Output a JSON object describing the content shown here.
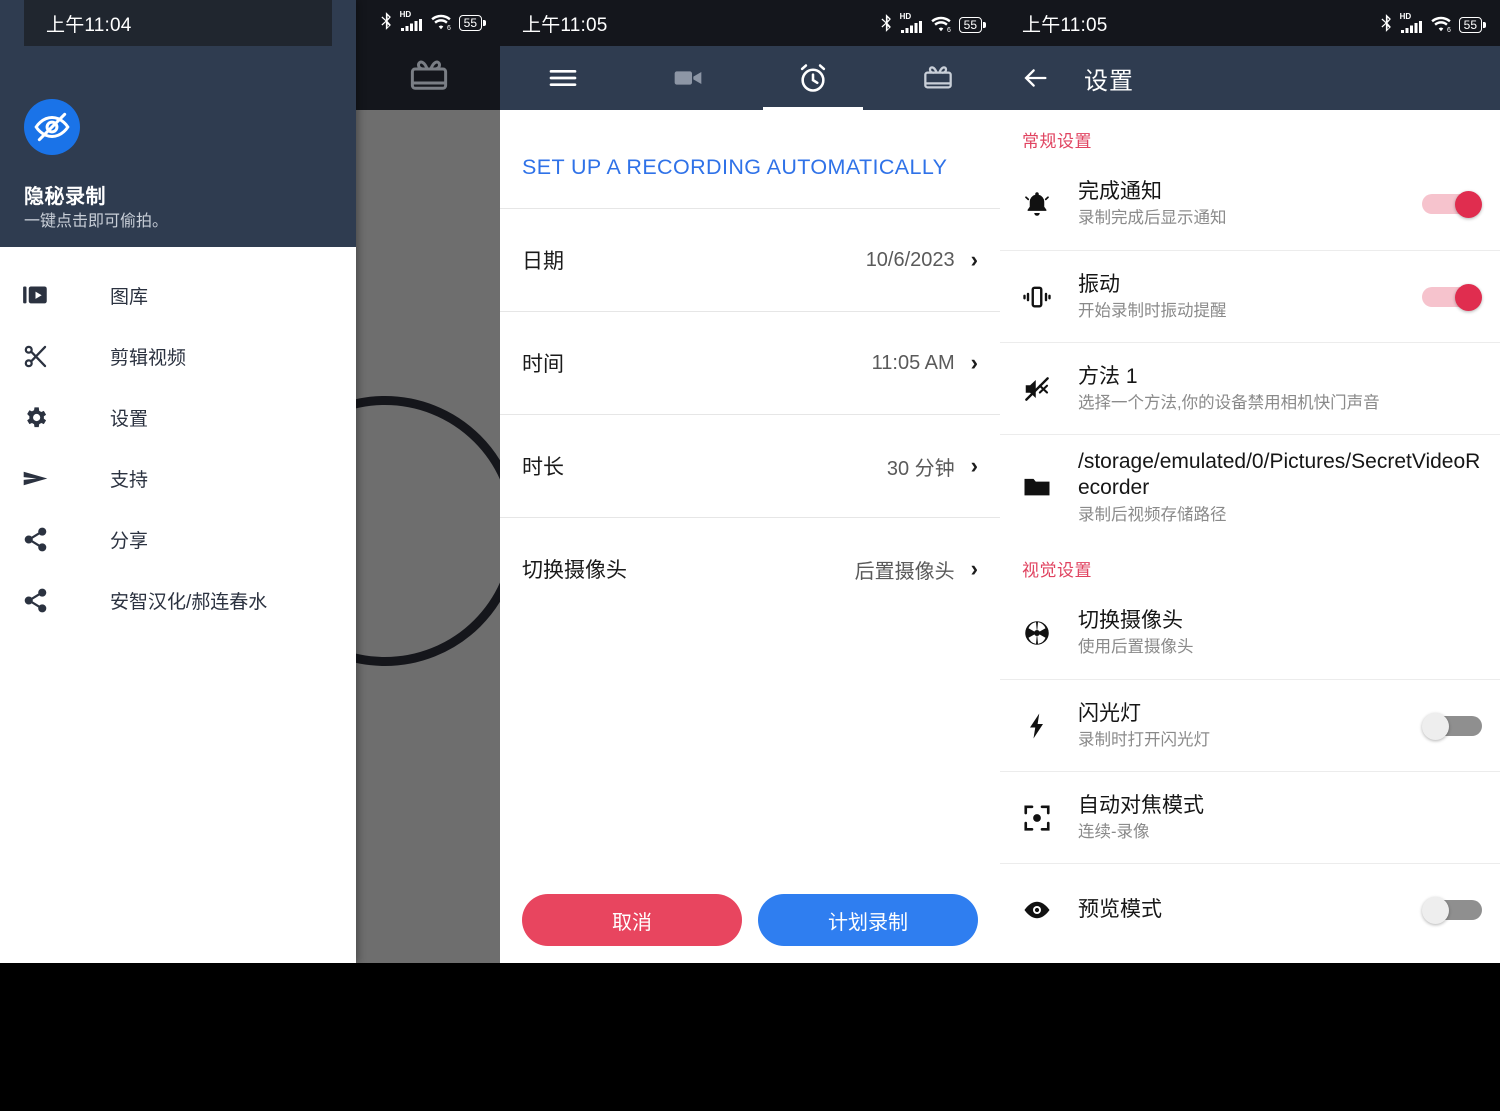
{
  "statusbar": {
    "left_time": "上午11:04",
    "mid_time": "上午11:05",
    "right_time": "上午11:05",
    "battery": "55",
    "network_label": "HD"
  },
  "drawer": {
    "app_name": "隐秘录制",
    "app_tagline": "一键点击即可偷拍。",
    "items": [
      {
        "icon": "gallery-icon",
        "label": "图库"
      },
      {
        "icon": "scissors-icon",
        "label": "剪辑视频"
      },
      {
        "icon": "gear-icon",
        "label": "设置"
      },
      {
        "icon": "send-icon",
        "label": "支持"
      },
      {
        "icon": "share-icon",
        "label": "分享"
      },
      {
        "icon": "share-icon",
        "label": "安智汉化/郝连春水"
      }
    ]
  },
  "schedule": {
    "tabs": [
      {
        "name": "menu-icon",
        "active": false
      },
      {
        "name": "video-camera-icon",
        "active": false
      },
      {
        "name": "alarm-clock-icon",
        "active": true
      },
      {
        "name": "gift-card-icon",
        "active": false
      }
    ],
    "section_title": "SET UP A RECORDING AUTOMATICALLY",
    "rows": [
      {
        "label": "日期",
        "value": "10/6/2023"
      },
      {
        "label": "时间",
        "value": "11:05 AM"
      },
      {
        "label": "时长",
        "value": "30 分钟"
      },
      {
        "label": "切换摄像头",
        "value": "后置摄像头"
      }
    ],
    "cancel_label": "取消",
    "confirm_label": "计划录制"
  },
  "settings": {
    "title": "设置",
    "groups": [
      {
        "heading": "常规设置",
        "items": [
          {
            "icon": "bell-icon",
            "title": "完成通知",
            "subtitle": "录制完成后显示通知",
            "toggle": "on"
          },
          {
            "icon": "vibration-icon",
            "title": "振动",
            "subtitle": "开始录制时振动提醒",
            "toggle": "on"
          },
          {
            "icon": "mute-icon",
            "title": "方法 1",
            "subtitle": "选择一个方法,你的设备禁用相机快门声音",
            "toggle": "none"
          },
          {
            "icon": "folder-icon",
            "title": "/storage/emulated/0/Pictures/SecretVideoRecorder",
            "subtitle": "录制后视频存储路径",
            "toggle": "none"
          }
        ]
      },
      {
        "heading": "视觉设置",
        "items": [
          {
            "icon": "aperture-icon",
            "title": "切换摄像头",
            "subtitle": "使用后置摄像头",
            "toggle": "none"
          },
          {
            "icon": "flash-icon",
            "title": "闪光灯",
            "subtitle": "录制时打开闪光灯",
            "toggle": "off"
          },
          {
            "icon": "focus-icon",
            "title": "自动对焦模式",
            "subtitle": "连续-录像",
            "toggle": "none"
          },
          {
            "icon": "eye-icon",
            "title": "预览模式",
            "subtitle": "",
            "toggle": "off"
          }
        ]
      }
    ]
  },
  "colors": {
    "appbar": "#2f3c50",
    "accent_red": "#e02d4f",
    "accent_blue": "#2f7ef0",
    "link_blue": "#2f72e8"
  }
}
